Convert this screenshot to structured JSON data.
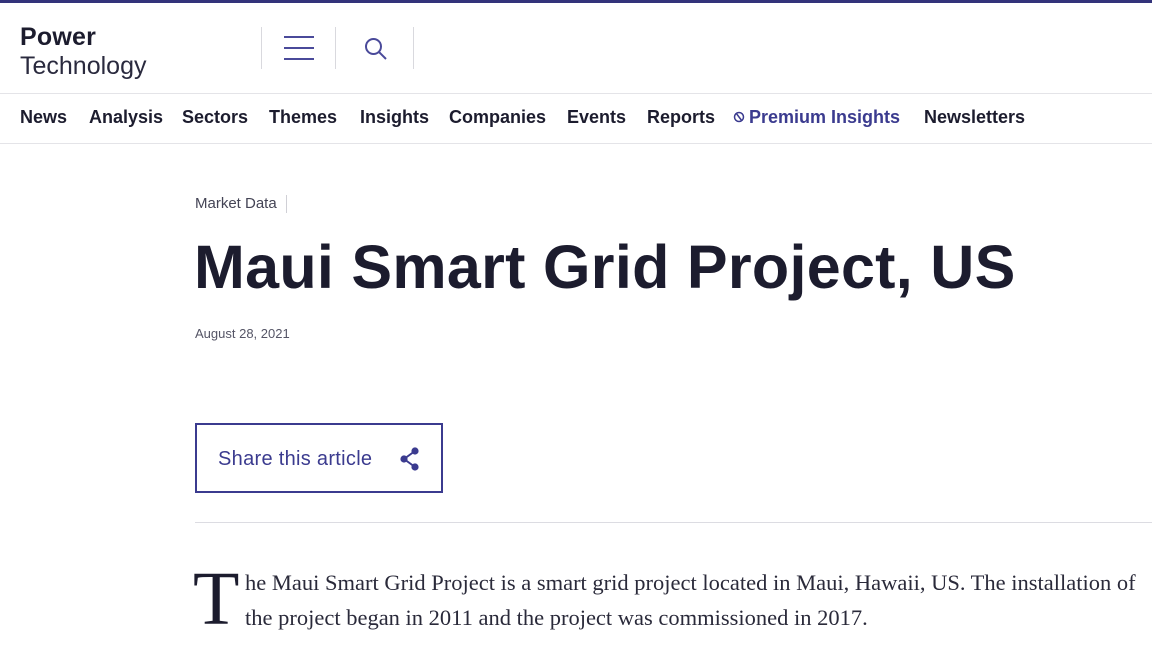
{
  "brand": {
    "line1": "Power",
    "line2": "Technology"
  },
  "nav": {
    "items": [
      {
        "label": "News"
      },
      {
        "label": "Analysis"
      },
      {
        "label": "Sectors"
      },
      {
        "label": "Themes"
      },
      {
        "label": "Insights"
      },
      {
        "label": "Companies"
      },
      {
        "label": "Events"
      },
      {
        "label": "Reports"
      },
      {
        "label": "Premium Insights"
      },
      {
        "label": "Newsletters"
      }
    ]
  },
  "article": {
    "category": "Market Data",
    "title": "Maui Smart Grid Project, US",
    "date": "August 28, 2021",
    "share_label": "Share this article",
    "dropcap": "T",
    "intro": "he Maui Smart Grid Project is a smart grid project located in Maui, Hawaii, US. The installation of the project began in 2011 and the project was commissioned in 2017."
  },
  "icons": {
    "menu": "hamburger-menu-icon",
    "search": "search-icon",
    "share": "share-icon",
    "premium": "premium-insights-icon"
  },
  "colors": {
    "accent": "#3b3b8f",
    "text": "#1c1c2e",
    "top_bar": "#33337a"
  }
}
